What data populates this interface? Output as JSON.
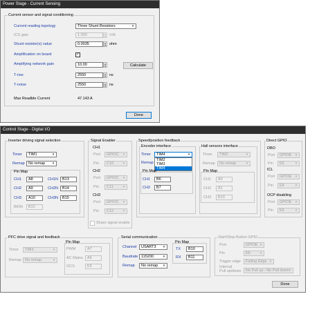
{
  "power_window": {
    "title": "Power Stage - Current Sensing",
    "group_title": "Current sensor and signal conditioning",
    "topology_label": "Current reading topology",
    "topology_value": "Three Shunt Resistors",
    "ics_gain_label": "ICS gain",
    "ics_gain_value": "1.000",
    "ics_gain_unit": "V/A",
    "shunt_label": "Shunt resistor(s) value",
    "shunt_value": "0.0035",
    "shunt_unit": "ohm",
    "amp_label": "Amplification on board",
    "amp_checked": "✓",
    "gain_label": "Amplifying network gain",
    "gain_value": "10.00",
    "calculate_label": "Calculate",
    "trise_label": "T-rise",
    "trise_value": "2550",
    "trise_unit": "ns",
    "tnoise_label": "T-noise",
    "tnoise_value": "2550",
    "tnoise_unit": "ns",
    "max_current_label": "Max Readble Current",
    "max_current_value": "47.143 A",
    "done_label": "Done"
  },
  "control_window": {
    "title": "Control Stage - Digital I/O",
    "inverter": {
      "title": "Inverter driving signal selection",
      "timer_label": "Timer",
      "timer_value": "TIM1",
      "remap_label": "Remap",
      "remap_value": "No remap",
      "pinmap_label": "Pin Map",
      "ch1_label": "CH1",
      "ch1_value": "A8",
      "ch1n_label": "CH1N",
      "ch1n_value": "B13",
      "ch2_label": "CH2",
      "ch2_value": "A9",
      "ch2n_label": "CH2N",
      "ch2n_value": "B14",
      "ch3_label": "CH3",
      "ch3_value": "A10",
      "ch3n_label": "CH3N",
      "ch3n_value": "B15",
      "bkin_label": "BKIN",
      "bkin_value": "B12"
    },
    "signal_enabler": {
      "title": "Signal Enabler",
      "ch1": "CH1",
      "ch2": "CH2",
      "ch3": "CH3",
      "port_label": "Port",
      "pin_label": "Pin",
      "port_value": "GPIOC",
      "ch1_pin": "C10",
      "ch2_pin": "C11",
      "ch3_pin": "C12",
      "share_label": "Share signal enable"
    },
    "speed": {
      "title": "Speed/position feedback",
      "encoder_title": "Encoder interface",
      "timer_label": "Timer",
      "timer_value": "TIM4",
      "remap_label": "Remap",
      "dropdown_options": [
        "TIM2",
        "TIM3",
        "TIM4"
      ],
      "pinmap_label": "Pin Map",
      "ch1_label": "CH1",
      "ch1_value": "B6",
      "ch2_label": "CH2",
      "ch2_value": "B7",
      "hall_title": "Hall sensors interface",
      "hall_timer_value": "TIM2",
      "hall_remap_value": "No remap",
      "hall_ch1_value": "A0",
      "hall_ch2_value": "A1",
      "hall_ch3_value": "B10"
    },
    "direct_gpio": {
      "title": "Direct GPIO",
      "dbo_label": "DBO",
      "dbo_port": "GPIOE",
      "dbo_pin": "E5",
      "icl_label": "ICL",
      "icl_port": "GPIOE",
      "icl_pin": "E4",
      "ocp_label": "OCP disabling",
      "ocp_port": "GPIOE",
      "ocp_pin": "E5",
      "port_label": "Port",
      "pin_label": "Pin"
    },
    "pfc": {
      "title": "PFC drive signal and feedback",
      "timer_label": "Timer",
      "timer_value": "TIM3",
      "remap_label": "Remap",
      "remap_value": "No remap",
      "pinmap_label": "Pin Map",
      "pwm_label": "PWM",
      "pwm_value": "A7",
      "acmains_label": "AC Mains",
      "acmains_value": "A6",
      "ocs_label": "OCS",
      "ocs_value": "E5"
    },
    "serial": {
      "title": "Serial communication",
      "channel_label": "Channel",
      "channel_value": "USART3",
      "baud_label": "Baudrate",
      "baud_value": "115200",
      "remap_label": "Remap",
      "remap_value": "No remap",
      "pinmap_label": "Pin Map",
      "tx_label": "TX",
      "tx_value": "B10",
      "rx_label": "RX",
      "rx_value": "B11"
    },
    "startstop": {
      "title": "Start/Stop Button GPIO",
      "port_label": "Port",
      "port_value": "GPIOE",
      "pin_label": "Pin",
      "pin_value": "E6",
      "trigger_label": "Trigger edge",
      "trigger_value": "Falling Edge",
      "internal_label_1": "Internal",
      "internal_label_2": "Pull up/down",
      "internal_value": "No Pull up - No Pull down"
    },
    "done_label": "Done"
  },
  "icons": {
    "dropdown_arrow": "chevron-down-icon",
    "spin": "spin-arrows-icon"
  }
}
